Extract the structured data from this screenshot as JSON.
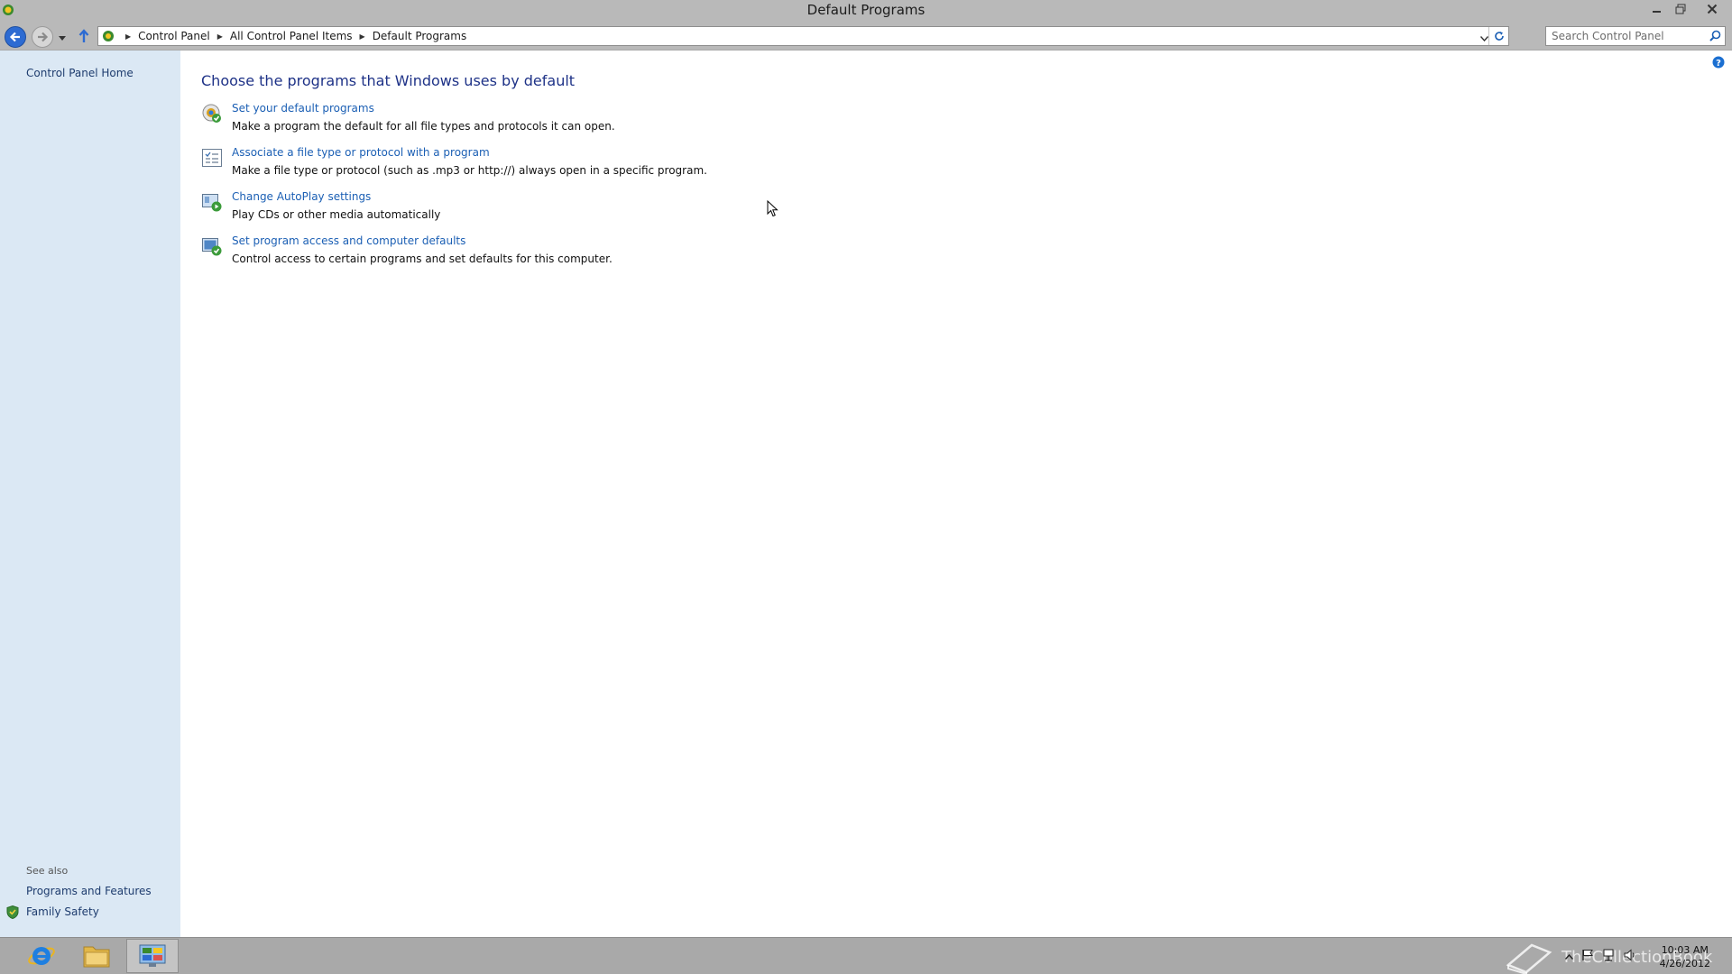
{
  "window": {
    "title": "Default Programs",
    "controls": {
      "minimize": "minimize",
      "restore": "restore",
      "close": "close"
    }
  },
  "address_bar": {
    "breadcrumbs": [
      "Control Panel",
      "All Control Panel Items",
      "Default Programs"
    ]
  },
  "search": {
    "placeholder": "Search Control Panel"
  },
  "left_pane": {
    "home_link": "Control Panel Home",
    "see_also_label": "See also",
    "see_also_links": [
      "Programs and Features",
      "Family Safety"
    ]
  },
  "main": {
    "heading": "Choose the programs that Windows uses by default",
    "tasks": [
      {
        "link": "Set your default programs",
        "description": "Make a program the default for all file types and protocols it can open.",
        "icon": "default-programs-icon"
      },
      {
        "link": "Associate a file type or protocol with a program",
        "description": "Make a file type or protocol (such as .mp3 or http://) always open in a specific program.",
        "icon": "file-association-icon"
      },
      {
        "link": "Change AutoPlay settings",
        "description": "Play CDs or other media automatically",
        "icon": "autoplay-icon"
      },
      {
        "link": "Set program access and computer defaults",
        "description": "Control access to certain programs and set defaults for this computer.",
        "icon": "program-access-icon"
      }
    ]
  },
  "taskbar": {
    "pinned": [
      "internet-explorer-icon",
      "file-explorer-icon",
      "control-panel-icon"
    ],
    "watermark": "TheCollectionBook",
    "clock": {
      "time": "10:03 AM",
      "date": "4/26/2012"
    }
  },
  "colors": {
    "chrome": "#b9b9b9",
    "left_pane": "#dbe8f4",
    "link": "#1b5fb4",
    "heading": "#1e3287",
    "taskbar": "#a9a9a9"
  }
}
